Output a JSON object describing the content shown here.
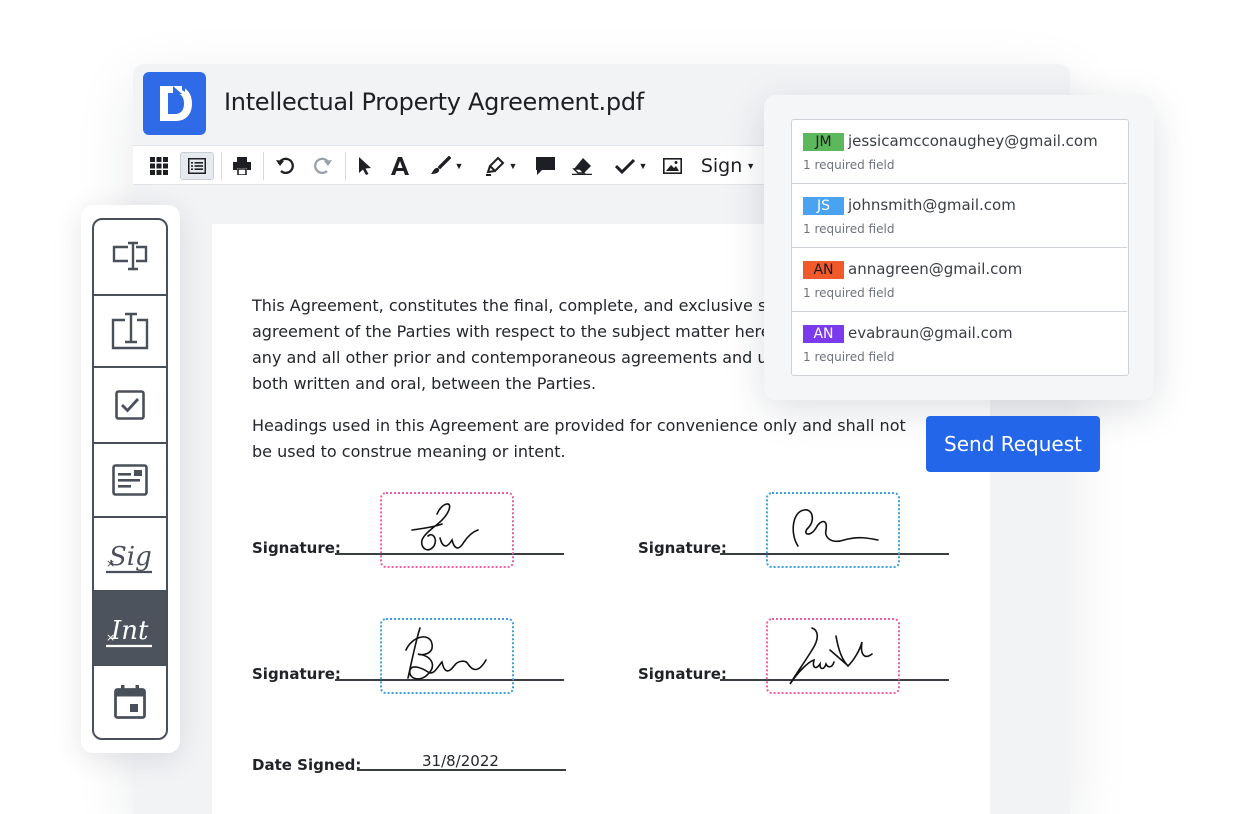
{
  "app": {
    "document_title": "Intellectual Property Agreement.pdf",
    "logo_icon": "docfly-logo-icon",
    "brand_color": "#2f6be6"
  },
  "toolbar": {
    "sign_label": "Sign",
    "tools": [
      "grid-view-icon",
      "list-view-icon",
      "print-icon",
      "undo-icon",
      "redo-icon",
      "select-pointer-icon",
      "text-icon",
      "draw-brush-icon",
      "highlighter-icon",
      "comment-icon",
      "eraser-icon",
      "checkmark-icon",
      "image-icon"
    ]
  },
  "document": {
    "paragraph1": [
      "This Agreement, constitutes the final, complete, and exclusive stater",
      "agreement of the Parties with respect to the subject matter hereof, a",
      "any and all other prior and contemporaneous agreements and under",
      "both written and oral, between the Parties."
    ],
    "paragraph2": [
      "Headings used in this Agreement are provided for convenience only and shall not",
      "be used to construe meaning or intent."
    ],
    "signature_label": "Signature:",
    "date_label": "Date Signed:",
    "date_value": "31/8/2022"
  },
  "palette": {
    "tools": [
      "text-field-icon",
      "text-box-icon",
      "checkbox-icon",
      "form-field-icon",
      "signature-tool-icon",
      "initials-tool-icon",
      "date-field-icon"
    ],
    "selected": "initials-tool-icon"
  },
  "recipients": [
    {
      "initials": "JM",
      "email": "jessicamcconaughey@gmail.com",
      "note": "1 required field",
      "color": "#5cb85c"
    },
    {
      "initials": "JS",
      "email": "johnsmith@gmail.com",
      "note": "1 required field",
      "color": "#4aa3f0"
    },
    {
      "initials": "AN",
      "email": "annagreen@gmail.com",
      "note": "1 required field",
      "color": "#f05a2a"
    },
    {
      "initials": "AN",
      "email": "evabraun@gmail.com",
      "note": "1 required field",
      "color": "#7c3aed"
    }
  ],
  "send_button": {
    "label": "Send Request",
    "color": "#2466ea"
  }
}
